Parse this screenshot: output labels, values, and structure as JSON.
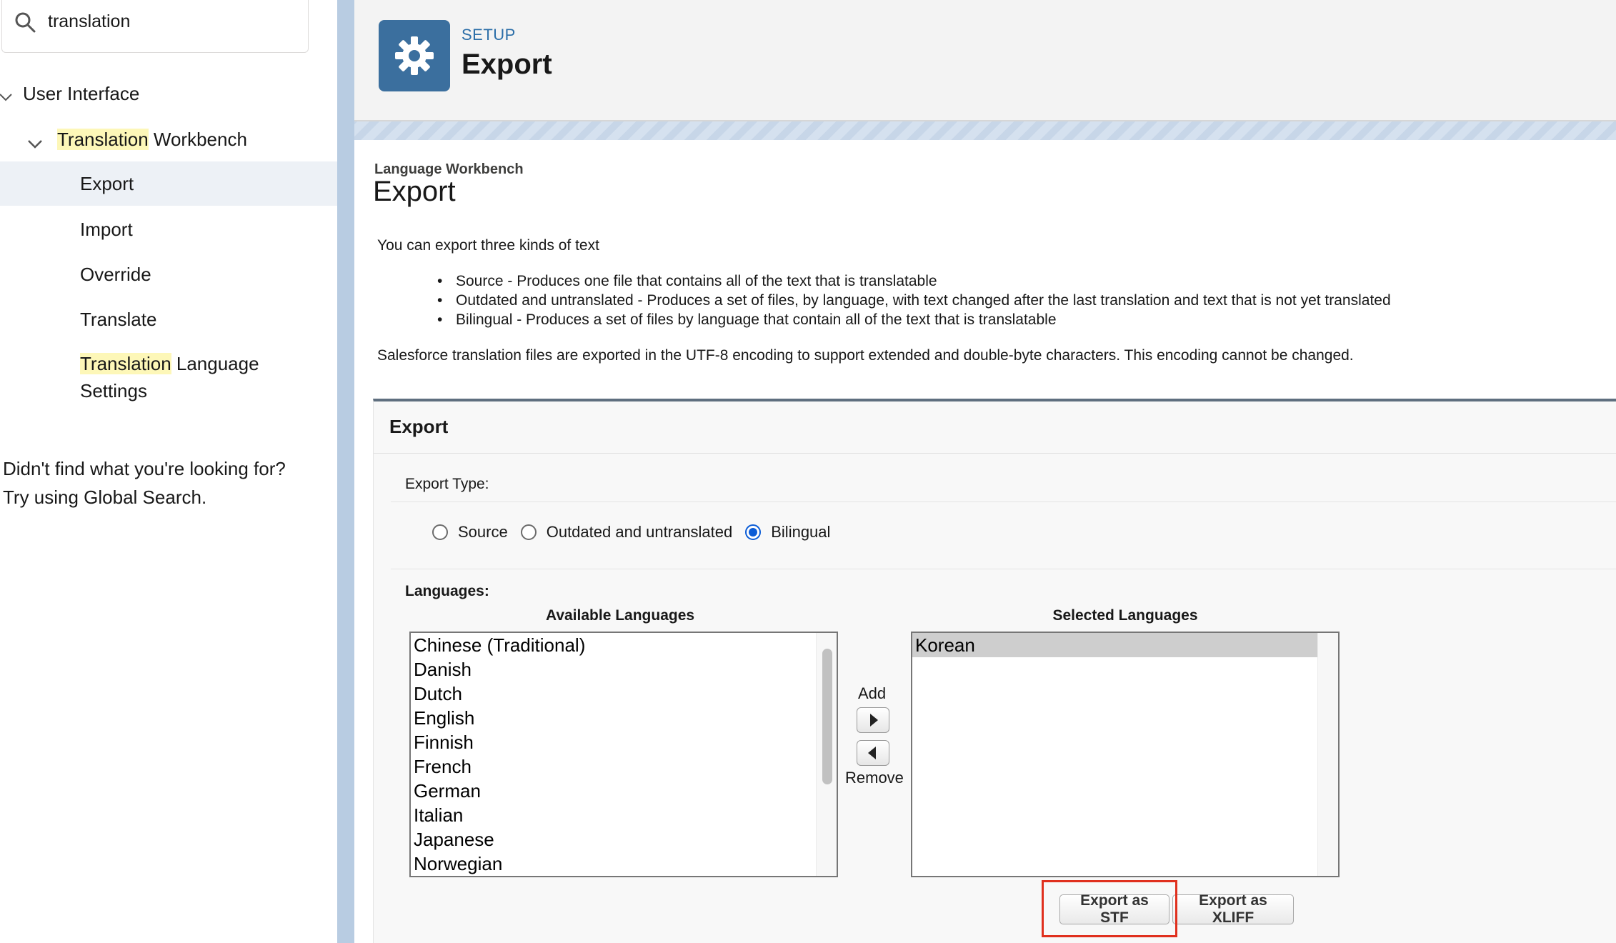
{
  "sidebar": {
    "search": {
      "value": "translation",
      "placeholder": "Quick Find"
    },
    "tree": {
      "user_interface": "User Interface",
      "translation_workbench": {
        "highlight": "Translation",
        "rest": " Workbench"
      },
      "items": [
        "Export",
        "Import",
        "Override",
        "Translate"
      ],
      "language_settings": {
        "highlight": "Translation",
        "rest": " Language",
        "line2": "Settings"
      }
    },
    "help_line1": "Didn't find what you're looking for?",
    "help_line2": "Try using Global Search."
  },
  "header": {
    "label": "SETUP",
    "title": "Export",
    "icon": "gear-icon"
  },
  "content": {
    "breadcrumb": "Language Workbench",
    "title": "Export",
    "intro": "You can export three kinds of text",
    "kinds": [
      "Source - Produces one file that contains all of the text that is translatable",
      "Outdated and untranslated - Produces a set of files, by language, with text changed after the last translation and text that is not yet translated",
      "Bilingual - Produces a set of files by language that contain all of the text that is translatable"
    ],
    "encoding_note": "Salesforce translation files are exported in the UTF-8 encoding to support extended and double-byte characters. This encoding cannot be changed."
  },
  "export_panel": {
    "title": "Export",
    "export_type_label": "Export Type:",
    "export_types": [
      "Source",
      "Outdated and untranslated",
      "Bilingual"
    ],
    "selected_export_type": "Bilingual",
    "languages_label": "Languages:",
    "available_title": "Available Languages",
    "available": [
      "Chinese (Traditional)",
      "Danish",
      "Dutch",
      "English",
      "Finnish",
      "French",
      "German",
      "Italian",
      "Japanese",
      "Norwegian"
    ],
    "selected_title": "Selected Languages",
    "selected": [
      "Korean"
    ],
    "add_label": "Add",
    "remove_label": "Remove",
    "export_stf_label": "Export as STF",
    "export_xliff_label": "Export as XLIFF"
  },
  "colors": {
    "accent": "#0b5cd6",
    "setup_icon_bg": "#3b6f9e",
    "highlight_search": "#fdf7b8",
    "annotation_red": "#e0301e"
  }
}
